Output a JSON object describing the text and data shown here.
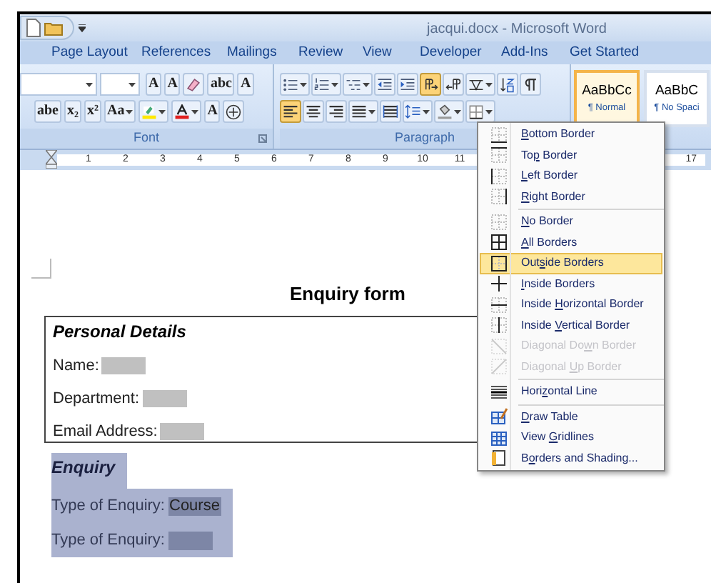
{
  "window": {
    "title": "jacqui.docx - Microsoft Word"
  },
  "tabs": [
    {
      "label": "Page Layout",
      "selected": false
    },
    {
      "label": "References",
      "selected": false
    },
    {
      "label": "Mailings",
      "selected": false
    },
    {
      "label": "Review",
      "selected": false
    },
    {
      "label": "View",
      "selected": false
    },
    {
      "label": "Developer",
      "selected": false
    },
    {
      "label": "Add-Ins",
      "selected": false
    },
    {
      "label": "Get Started",
      "selected": false
    }
  ],
  "font_group": {
    "label": "Font",
    "row_1": [
      {
        "kind": "glyph",
        "text": "A",
        "dropdown": false
      },
      {
        "kind": "glyph",
        "text": "A",
        "dropdown": false
      },
      {
        "kind": "eraser",
        "dropdown": false
      },
      {
        "kind": "glyph",
        "text": "abc",
        "dropdown": false
      },
      {
        "kind": "glyph",
        "text": "A",
        "dropdown": false
      }
    ],
    "row_2": [
      {
        "kind": "glyph",
        "text": "abe",
        "dropdown": false
      },
      {
        "kind": "glyph",
        "text": "x₂",
        "dropdown": false
      },
      {
        "kind": "glyph",
        "text": "x²",
        "dropdown": false
      },
      {
        "kind": "glyph",
        "text": "Aa",
        "dropdown": true
      },
      {
        "kind": "highlighter",
        "dropdown": true
      },
      {
        "kind": "font-color",
        "dropdown": true
      },
      {
        "kind": "glyph",
        "text": "A",
        "dropdown": false
      },
      {
        "kind": "circle",
        "dropdown": false
      }
    ]
  },
  "paragraph_group": {
    "label": "Paragraph",
    "row_1": [
      {
        "kind": "bullets",
        "dropdown": true,
        "selected": false
      },
      {
        "kind": "numbering",
        "dropdown": true,
        "selected": false
      },
      {
        "kind": "multilevel",
        "dropdown": true,
        "selected": false
      },
      {
        "kind": "outdent",
        "dropdown": false,
        "selected": false
      },
      {
        "kind": "indent",
        "dropdown": false,
        "selected": false
      },
      {
        "kind": "ltr",
        "dropdown": false,
        "selected": true
      },
      {
        "kind": "rtl",
        "dropdown": false,
        "selected": false
      },
      {
        "kind": "asian",
        "dropdown": true,
        "selected": false
      },
      {
        "kind": "sort",
        "dropdown": false,
        "selected": false
      },
      {
        "kind": "pilcrow",
        "dropdown": false,
        "selected": false
      }
    ],
    "row_2": [
      {
        "kind": "align-left",
        "dropdown": false,
        "selected": true
      },
      {
        "kind": "align-center",
        "dropdown": false,
        "selected": false
      },
      {
        "kind": "align-right",
        "dropdown": false,
        "selected": false
      },
      {
        "kind": "justify",
        "dropdown": true,
        "selected": false
      },
      {
        "kind": "distributed",
        "dropdown": false,
        "selected": false
      },
      {
        "kind": "line-spacing",
        "dropdown": true,
        "selected": false
      },
      {
        "kind": "shading",
        "dropdown": true,
        "selected": false
      },
      {
        "kind": "borders",
        "dropdown": true,
        "selected": false
      }
    ]
  },
  "styles": [
    {
      "sample": "AaBbCc",
      "name": "¶ Normal",
      "selected": true
    },
    {
      "sample": "AaBbC",
      "name": "¶ No Spaci",
      "selected": false
    }
  ],
  "ruler": {
    "numbers": [
      "1",
      "2",
      "3",
      "4",
      "5",
      "6",
      "7",
      "8",
      "9",
      "10",
      "11"
    ],
    "right_number": "17"
  },
  "document": {
    "title": "Enquiry form",
    "section_1": {
      "heading": "Personal Details",
      "fields": [
        {
          "label": "Name:"
        },
        {
          "label": "Department:"
        },
        {
          "label": "Email Address:"
        }
      ]
    },
    "section_2": {
      "heading": "Enquiry",
      "fields": [
        {
          "label": "Type of Enquiry:",
          "value": "Course"
        },
        {
          "label": "Type of Enquiry:"
        }
      ]
    }
  },
  "border_menu": [
    [
      {
        "kind": "bottom",
        "access_key": "B",
        "after": "ottom Border",
        "selected": false,
        "disabled": false
      },
      {
        "kind": "top",
        "before": "To",
        "access_key": "p",
        "after": " Border",
        "selected": false,
        "disabled": false
      },
      {
        "kind": "left",
        "access_key": "L",
        "after": "eft Border",
        "selected": false,
        "disabled": false
      },
      {
        "kind": "right",
        "access_key": "R",
        "after": "ight Border",
        "selected": false,
        "disabled": false
      }
    ],
    [
      {
        "kind": "none",
        "access_key": "N",
        "after": "o Border",
        "selected": false,
        "disabled": false
      },
      {
        "kind": "all",
        "access_key": "A",
        "after": "ll Borders",
        "selected": false,
        "disabled": false
      },
      {
        "kind": "outside",
        "before": "Out",
        "access_key": "s",
        "after": "ide Borders",
        "selected": true,
        "disabled": false
      },
      {
        "kind": "inside",
        "access_key": "I",
        "after": "nside Borders",
        "selected": false,
        "disabled": false
      },
      {
        "kind": "inside-h",
        "before": "Inside ",
        "access_key": "H",
        "after": "orizontal Border",
        "selected": false,
        "disabled": false
      },
      {
        "kind": "inside-v",
        "before": "Inside ",
        "access_key": "V",
        "after": "ertical Border",
        "selected": false,
        "disabled": false
      },
      {
        "kind": "diag-down",
        "before": "Diagonal Do",
        "access_key": "w",
        "after": "n Border",
        "selected": false,
        "disabled": true
      },
      {
        "kind": "diag-up",
        "before": "Diagonal ",
        "access_key": "U",
        "after": "p Border",
        "selected": false,
        "disabled": true
      }
    ],
    [
      {
        "kind": "hline",
        "before": "Hori",
        "access_key": "z",
        "after": "ontal Line",
        "selected": false,
        "disabled": false
      }
    ],
    [
      {
        "kind": "draw",
        "access_key": "D",
        "after": "raw Table",
        "selected": false,
        "disabled": false
      },
      {
        "kind": "grid",
        "before": "View ",
        "access_key": "G",
        "after": "ridlines",
        "selected": false,
        "disabled": false
      },
      {
        "kind": "shading",
        "before": "B",
        "access_key": "o",
        "after": "rders and Shading...",
        "selected": false,
        "disabled": false
      }
    ]
  ]
}
